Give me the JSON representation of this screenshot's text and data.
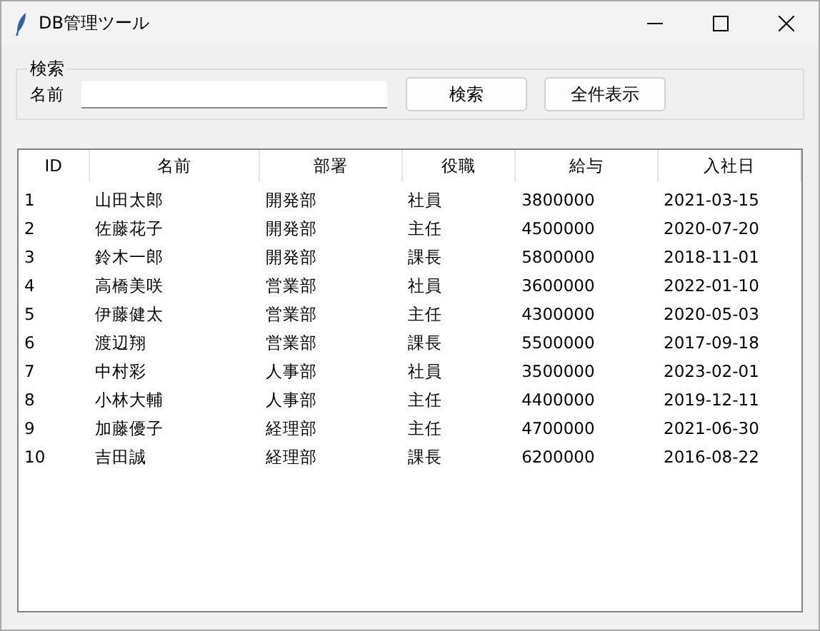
{
  "window": {
    "title": "DB管理ツール"
  },
  "search": {
    "group_label": "検索",
    "field_label": "名前",
    "buttons": [
      "検索",
      "全件表示"
    ]
  },
  "table": {
    "columns": [
      "ID",
      "名前",
      "部署",
      "役職",
      "給与",
      "入社日"
    ],
    "rows": [
      [
        "1",
        "山田太郎",
        "開発部",
        "社員",
        "3800000",
        "2021-03-15"
      ],
      [
        "2",
        "佐藤花子",
        "開発部",
        "主任",
        "4500000",
        "2020-07-20"
      ],
      [
        "3",
        "鈴木一郎",
        "開発部",
        "課長",
        "5800000",
        "2018-11-01"
      ],
      [
        "4",
        "高橋美咲",
        "営業部",
        "社員",
        "3600000",
        "2022-01-10"
      ],
      [
        "5",
        "伊藤健太",
        "営業部",
        "主任",
        "4300000",
        "2020-05-03"
      ],
      [
        "6",
        "渡辺翔",
        "営業部",
        "課長",
        "5500000",
        "2017-09-18"
      ],
      [
        "7",
        "中村彩",
        "人事部",
        "社員",
        "3500000",
        "2023-02-01"
      ],
      [
        "8",
        "小林大輔",
        "人事部",
        "主任",
        "4400000",
        "2019-12-11"
      ],
      [
        "9",
        "加藤優子",
        "経理部",
        "主任",
        "4700000",
        "2021-06-30"
      ],
      [
        "10",
        "吉田誠",
        "経理部",
        "課長",
        "6200000",
        "2016-08-22"
      ]
    ]
  }
}
